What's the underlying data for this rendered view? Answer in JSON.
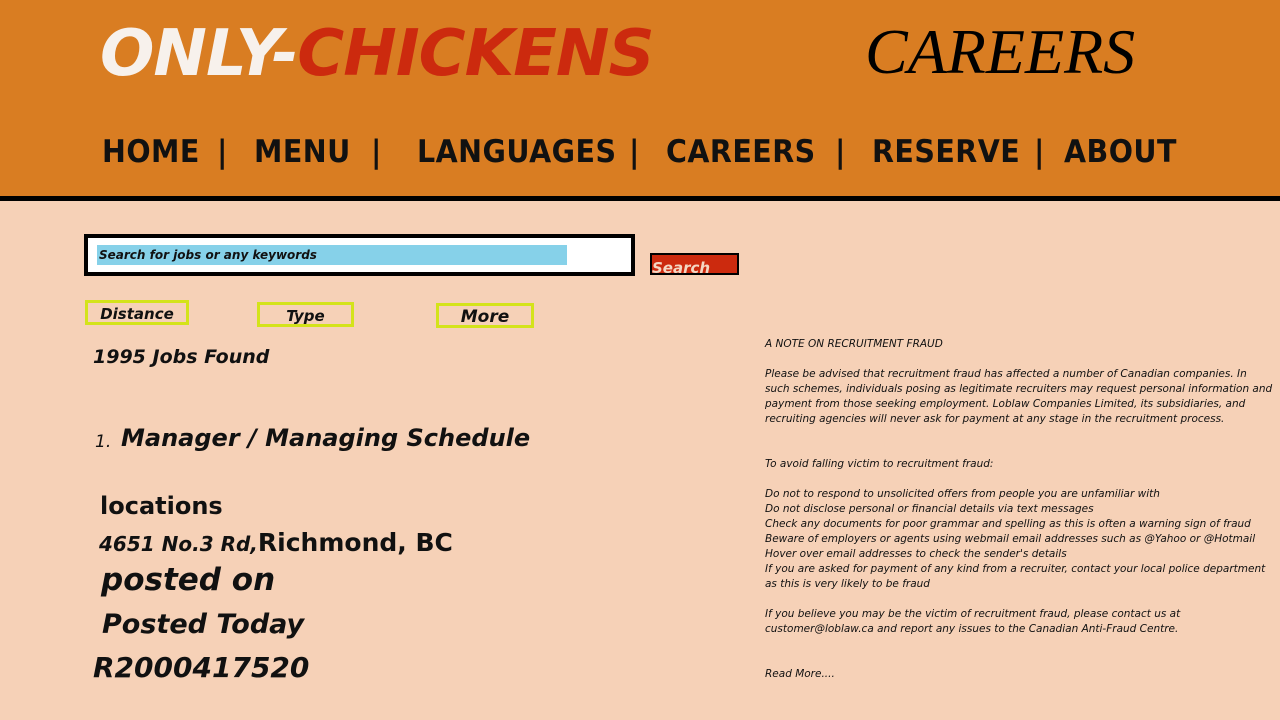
{
  "header": {
    "brand_part1": "ONLY-",
    "brand_part2": "CHICKENS",
    "page_heading": "CAREERS",
    "colors": {
      "header_bg": "#d97d22",
      "brand_white": "#f7f1ec",
      "brand_red": "#cc2a0e",
      "page_bg": "#f6d1b7"
    }
  },
  "nav": {
    "items": [
      "HOME",
      "MENU",
      "LANGUAGES",
      "CAREERS",
      "RESERVE",
      "ABOUT"
    ],
    "separator": "|"
  },
  "search": {
    "placeholder": "Search for jobs or any keywords",
    "button_label": "Search"
  },
  "filters": [
    "Distance",
    "Type",
    "More"
  ],
  "results": {
    "count_text": "1995 Jobs Found",
    "jobs": [
      {
        "index": "1.",
        "title": "Manager / Managing Schedule",
        "locations_label": "locations",
        "address": "4651 No.3 Rd,",
        "city": "Richmond, BC",
        "posted_label": "posted on",
        "posted_value": "Posted Today",
        "requisition_id": "R2000417520"
      }
    ]
  },
  "fraud_note": {
    "heading": "A NOTE ON RECRUITMENT FRAUD",
    "intro": "Please be advised that recruitment fraud has affected a number of Canadian companies. In such schemes, individuals posing as legitimate recruiters may request personal information and payment from those seeking employment. Loblaw Companies Limited, its subsidiaries, and recruiting agencies will never ask for payment at any stage in the recruitment process.",
    "tips_heading": "To avoid falling victim to recruitment fraud:",
    "tips": [
      "Do not to respond to unsolicited offers from people you are unfamiliar with",
      "Do not disclose personal or financial details via text messages",
      "Check any documents for poor grammar and spelling as this is often a warning sign of fraud",
      "Beware of employers or agents using webmail email addresses such as @Yahoo or @Hotmail",
      "Hover over email addresses to check the sender's details",
      "If you are asked for payment of any kind from a recruiter, contact your local police department as this is very likely to be fraud"
    ],
    "contact": "If you believe you may be the victim of recruitment fraud, please contact us at customer@loblaw.ca and report any issues to the Canadian Anti-Fraud Centre.",
    "read_more": "Read More...."
  }
}
